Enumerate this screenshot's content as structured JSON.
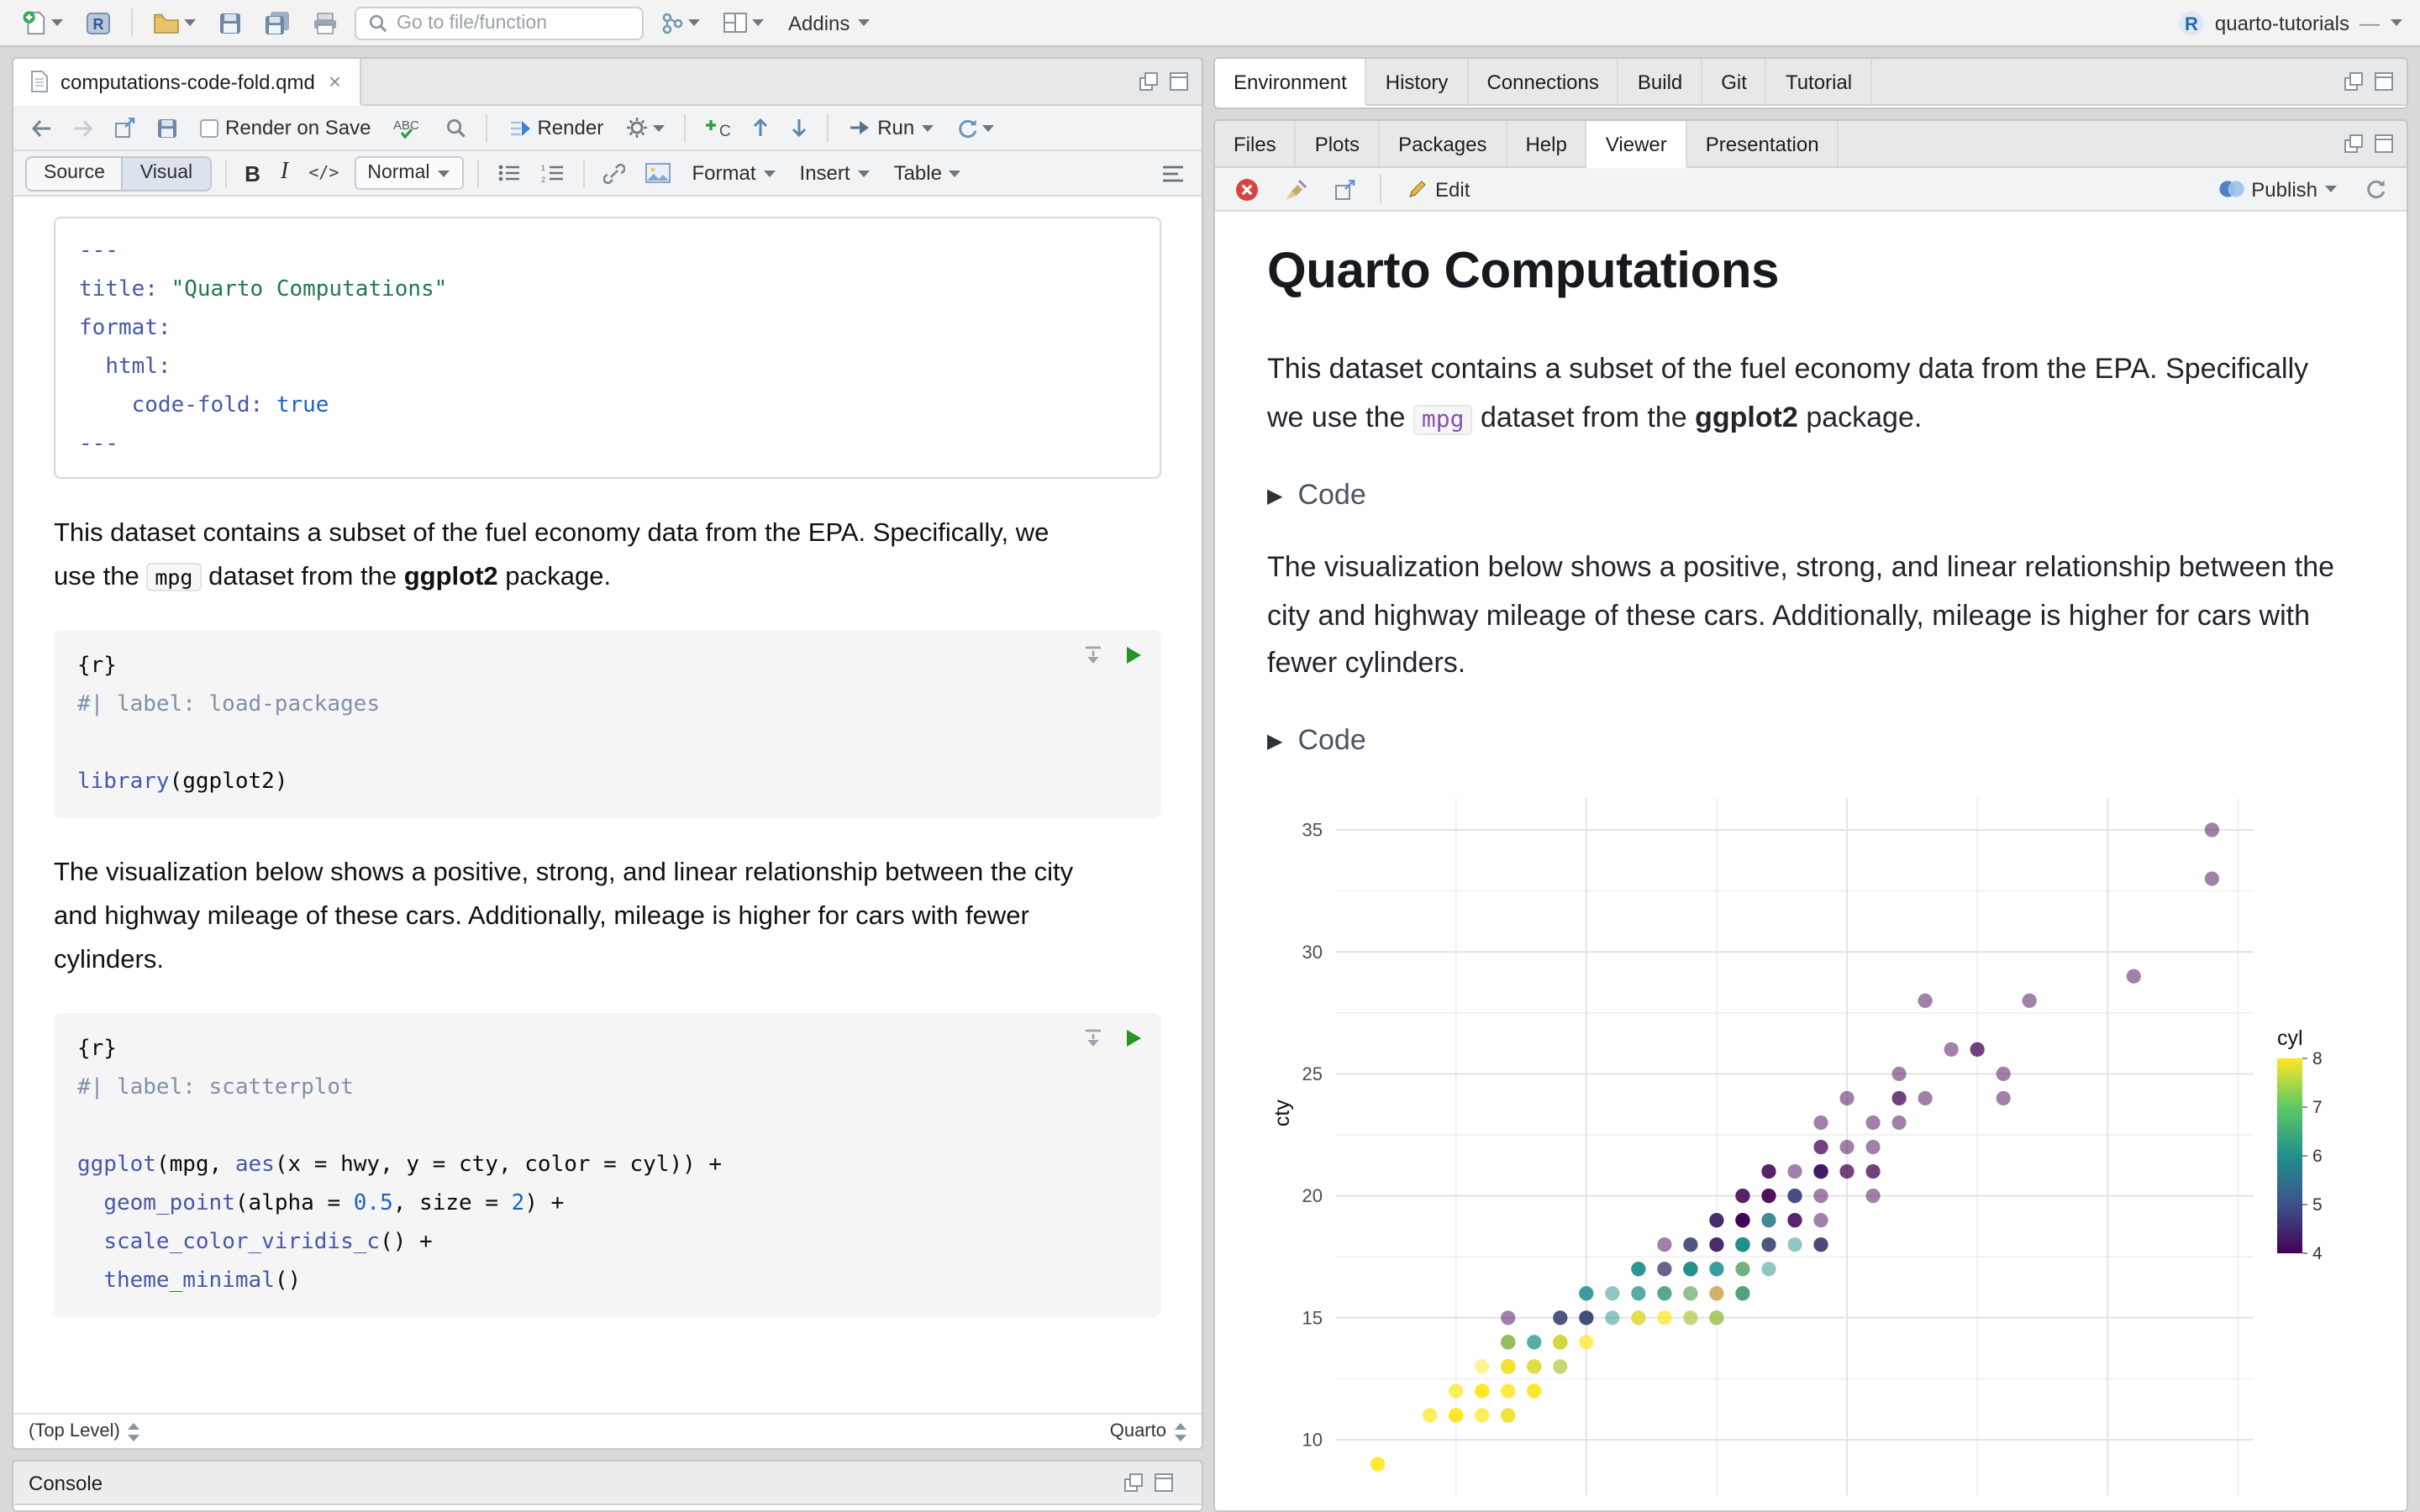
{
  "main_toolbar": {
    "goto_placeholder": "Go to file/function",
    "addins_label": "Addins",
    "project_name": "quarto-tutorials"
  },
  "editor_pane": {
    "tab_title": "computations-code-fold.qmd",
    "tab_close": "×",
    "toolbar": {
      "render_on_save_label": "Render on Save",
      "render_label": "Render",
      "run_label": "Run"
    },
    "format_bar": {
      "source_label": "Source",
      "visual_label": "Visual",
      "bold_label": "B",
      "italic_label": "I",
      "code_label": "</>",
      "paragraph_style": "Normal",
      "format_label": "Format",
      "insert_label": "Insert",
      "table_label": "Table"
    },
    "yaml_block": [
      [
        [
          "blu",
          "---"
        ]
      ],
      [
        [
          "blu",
          "title:"
        ],
        [
          "pl",
          " "
        ],
        [
          "grn",
          "\"Quarto Computations\""
        ]
      ],
      [
        [
          "blu",
          "format:"
        ]
      ],
      [
        [
          "pl",
          "  "
        ],
        [
          "blu",
          "html:"
        ]
      ],
      [
        [
          "pl",
          "    "
        ],
        [
          "blu",
          "code-fold:"
        ],
        [
          "pl",
          " "
        ],
        [
          "num",
          "true"
        ]
      ],
      [
        [
          "blu",
          "---"
        ]
      ]
    ],
    "paragraph_1": [
      {
        "s": "plain",
        "t": "This dataset contains a subset of the fuel economy data from the EPA. Specifically, we use the "
      },
      {
        "s": "code",
        "t": "mpg"
      },
      {
        "s": "plain",
        "t": " dataset from the "
      },
      {
        "s": "bold",
        "t": "ggplot2"
      },
      {
        "s": "plain",
        "t": " package."
      }
    ],
    "chunk_1": [
      [
        [
          "pl",
          "{r}"
        ]
      ],
      [
        [
          "cmt",
          "#| label: load-packages"
        ]
      ],
      [],
      [
        [
          "blu",
          "library"
        ],
        [
          "pl",
          "(ggplot2)"
        ]
      ]
    ],
    "paragraph_2": [
      {
        "s": "plain",
        "t": "The visualization below shows a positive, strong, and linear relationship between the city and highway mileage of these cars. Additionally, mileage is higher for cars with fewer cylinders."
      }
    ],
    "chunk_2": [
      [
        [
          "pl",
          "{r}"
        ]
      ],
      [
        [
          "cmt",
          "#| label: scatterplot"
        ]
      ],
      [],
      [
        [
          "blu",
          "ggplot"
        ],
        [
          "pl",
          "(mpg, "
        ],
        [
          "blu",
          "aes"
        ],
        [
          "pl",
          "(x = hwy, y = cty, color = cyl)) +"
        ]
      ],
      [
        [
          "pl",
          "  "
        ],
        [
          "blu",
          "geom_point"
        ],
        [
          "pl",
          "(alpha = "
        ],
        [
          "num",
          "0.5"
        ],
        [
          "pl",
          ", size = "
        ],
        [
          "num",
          "2"
        ],
        [
          "pl",
          ") +"
        ]
      ],
      [
        [
          "pl",
          "  "
        ],
        [
          "blu",
          "scale_color_viridis_c"
        ],
        [
          "pl",
          "() +"
        ]
      ],
      [
        [
          "pl",
          "  "
        ],
        [
          "blu",
          "theme_minimal"
        ],
        [
          "pl",
          "()"
        ]
      ]
    ],
    "status_bar": {
      "left": "(Top Level)",
      "right": "Quarto"
    }
  },
  "console_pane": {
    "title": "Console"
  },
  "environment_pane": {
    "tabs": [
      "Environment",
      "History",
      "Connections",
      "Build",
      "Git",
      "Tutorial"
    ]
  },
  "viewer_pane": {
    "tabs": [
      "Files",
      "Plots",
      "Packages",
      "Help",
      "Viewer",
      "Presentation"
    ],
    "active_tab": "Viewer",
    "toolbar": {
      "edit_label": "Edit",
      "publish_label": "Publish"
    },
    "document": {
      "title": "Quarto Computations",
      "paragraph_1": [
        {
          "s": "plain",
          "t": "This dataset contains a subset of the fuel economy data from the EPA. Specifically we use the "
        },
        {
          "s": "code",
          "t": "mpg"
        },
        {
          "s": "plain",
          "t": " dataset from the "
        },
        {
          "s": "bold",
          "t": "ggplot2"
        },
        {
          "s": "plain",
          "t": " package."
        }
      ],
      "code_fold_label": "Code",
      "paragraph_2": [
        {
          "s": "plain",
          "t": "The visualization below shows a positive, strong, and linear relationship between the city and highway mileage of these cars. Additionally, mileage is higher for cars with fewer cylinders."
        }
      ]
    }
  },
  "chart_data": {
    "type": "scatter",
    "x_var": "hwy",
    "ylabel": "cty",
    "x_domain": [
      10.4,
      45.6
    ],
    "y_domain": [
      7.7,
      36.3
    ],
    "y_ticks": [
      10,
      15,
      20,
      25,
      30,
      35
    ],
    "y_minor_gridlines": [
      12.5,
      17.5,
      22.5,
      27.5,
      32.5
    ],
    "x_major_gridlines": [
      20,
      30,
      40
    ],
    "x_minor_gridlines": [
      15,
      25,
      35,
      45
    ],
    "x_axis_labels_visible": false,
    "grid": true,
    "point_alpha": 0.5,
    "point_radius": 4.3,
    "color_scale": {
      "variable": "cyl",
      "name": "viridis",
      "domain": [
        4,
        8
      ],
      "stops": [
        "#440154",
        "#3b528b",
        "#21908c",
        "#5dc863",
        "#fde725"
      ],
      "legend_title": "cyl",
      "legend_ticks": [
        8,
        7,
        6,
        5,
        4
      ],
      "legend_position": "right"
    },
    "point_key": [
      "hwy",
      "cty",
      "cyl"
    ],
    "points": [
      [
        29,
        18,
        4
      ],
      [
        29,
        21,
        4
      ],
      [
        31,
        20,
        4
      ],
      [
        30,
        21,
        4
      ],
      [
        26,
        16,
        6
      ],
      [
        26,
        18,
        6
      ],
      [
        27,
        18,
        6
      ],
      [
        26,
        18,
        4
      ],
      [
        25,
        16,
        4
      ],
      [
        28,
        20,
        4
      ],
      [
        27,
        19,
        4
      ],
      [
        25,
        15,
        6
      ],
      [
        25,
        17,
        6
      ],
      [
        25,
        17,
        6
      ],
      [
        25,
        15,
        6
      ],
      [
        24,
        15,
        6
      ],
      [
        25,
        17,
        6
      ],
      [
        23,
        16,
        8
      ],
      [
        20,
        14,
        8
      ],
      [
        15,
        11,
        8
      ],
      [
        20,
        14,
        8
      ],
      [
        17,
        13,
        8
      ],
      [
        17,
        12,
        8
      ],
      [
        26,
        16,
        8
      ],
      [
        23,
        15,
        8
      ],
      [
        26,
        16,
        8
      ],
      [
        24,
        15,
        8
      ],
      [
        25,
        15,
        8
      ],
      [
        19,
        14,
        8
      ],
      [
        14,
        11,
        8
      ],
      [
        15,
        11,
        8
      ],
      [
        19,
        14,
        8
      ],
      [
        27,
        19,
        6
      ],
      [
        30,
        22,
        4
      ],
      [
        29,
        18,
        6
      ],
      [
        26,
        17,
        6
      ],
      [
        27,
        18,
        6
      ],
      [
        24,
        18,
        6
      ],
      [
        24,
        17,
        6
      ],
      [
        22,
        16,
        6
      ],
      [
        22,
        16,
        6
      ],
      [
        22,
        17,
        6
      ],
      [
        21,
        15,
        6
      ],
      [
        23,
        17,
        6
      ],
      [
        23,
        16,
        6
      ],
      [
        17,
        11,
        6
      ],
      [
        22,
        15,
        6
      ],
      [
        21,
        16,
        6
      ],
      [
        19,
        15,
        6
      ],
      [
        18,
        14,
        6
      ],
      [
        17,
        13,
        8
      ],
      [
        17,
        13,
        8
      ],
      [
        12,
        9,
        8
      ],
      [
        17,
        13,
        8
      ],
      [
        16,
        12,
        8
      ],
      [
        19,
        14,
        6
      ],
      [
        17,
        12,
        8
      ],
      [
        17,
        13,
        6
      ],
      [
        12,
        9,
        8
      ],
      [
        17,
        13,
        8
      ],
      [
        17,
        13,
        8
      ],
      [
        16,
        11,
        8
      ],
      [
        18,
        13,
        8
      ],
      [
        15,
        11,
        8
      ],
      [
        17,
        13,
        8
      ],
      [
        15,
        11,
        8
      ],
      [
        16,
        12,
        8
      ],
      [
        12,
        9,
        8
      ],
      [
        15,
        11,
        8
      ],
      [
        16,
        12,
        8
      ],
      [
        15,
        12,
        8
      ],
      [
        16,
        12,
        8
      ],
      [
        17,
        12,
        8
      ],
      [
        15,
        11,
        8
      ],
      [
        17,
        11,
        8
      ],
      [
        17,
        11,
        8
      ],
      [
        18,
        12,
        8
      ],
      [
        17,
        14,
        6
      ],
      [
        17,
        13,
        6
      ],
      [
        19,
        14,
        6
      ],
      [
        18,
        13,
        6
      ],
      [
        17,
        13,
        6
      ],
      [
        18,
        14,
        6
      ],
      [
        15,
        12,
        8
      ],
      [
        16,
        12,
        8
      ],
      [
        17,
        13,
        8
      ],
      [
        17,
        13,
        8
      ],
      [
        15,
        11,
        8
      ],
      [
        16,
        12,
        8
      ],
      [
        16,
        13,
        8
      ],
      [
        26,
        18,
        6
      ],
      [
        25,
        18,
        6
      ],
      [
        26,
        18,
        6
      ],
      [
        24,
        17,
        6
      ],
      [
        22,
        15,
        8
      ],
      [
        23,
        15,
        8
      ],
      [
        22,
        15,
        8
      ],
      [
        24,
        16,
        8
      ],
      [
        26,
        17,
        8
      ],
      [
        33,
        28,
        4
      ],
      [
        32,
        24,
        4
      ],
      [
        32,
        25,
        4
      ],
      [
        29,
        23,
        4
      ],
      [
        32,
        24,
        4
      ],
      [
        34,
        26,
        4
      ],
      [
        36,
        25,
        4
      ],
      [
        36,
        24,
        4
      ],
      [
        29,
        21,
        4
      ],
      [
        26,
        18,
        4
      ],
      [
        27,
        18,
        4
      ],
      [
        28,
        19,
        4
      ],
      [
        26,
        18,
        4
      ],
      [
        26,
        18,
        6
      ],
      [
        24,
        17,
        6
      ],
      [
        24,
        16,
        6
      ],
      [
        26,
        19,
        4
      ],
      [
        29,
        19,
        4
      ],
      [
        27,
        20,
        4
      ],
      [
        27,
        20,
        4
      ],
      [
        26,
        20,
        4
      ],
      [
        24,
        17,
        6
      ],
      [
        24,
        17,
        6
      ],
      [
        20,
        15,
        6
      ],
      [
        22,
        17,
        6
      ],
      [
        19,
        14,
        8
      ],
      [
        12,
        9,
        8
      ],
      [
        19,
        14,
        8
      ],
      [
        14,
        11,
        8
      ],
      [
        15,
        11,
        8
      ],
      [
        16,
        12,
        8
      ],
      [
        15,
        11,
        8
      ],
      [
        18,
        12,
        8
      ],
      [
        15,
        11,
        8
      ],
      [
        18,
        12,
        8
      ],
      [
        17,
        11,
        8
      ],
      [
        16,
        11,
        8
      ],
      [
        18,
        12,
        8
      ],
      [
        17,
        14,
        6
      ],
      [
        19,
        13,
        6
      ],
      [
        19,
        13,
        8
      ],
      [
        17,
        13,
        8
      ],
      [
        29,
        21,
        4
      ],
      [
        32,
        23,
        4
      ],
      [
        31,
        23,
        4
      ],
      [
        26,
        19,
        6
      ],
      [
        27,
        19,
        6
      ],
      [
        25,
        18,
        6
      ],
      [
        25,
        19,
        6
      ],
      [
        25,
        19,
        6
      ],
      [
        17,
        14,
        6
      ],
      [
        17,
        14,
        6
      ],
      [
        18,
        12,
        8
      ],
      [
        18,
        13,
        8
      ],
      [
        24,
        18,
        6
      ],
      [
        26,
        18,
        6
      ],
      [
        26,
        16,
        6
      ],
      [
        27,
        17,
        6
      ],
      [
        28,
        18,
        6
      ],
      [
        25,
        16,
        8
      ],
      [
        25,
        18,
        4
      ],
      [
        24,
        18,
        4
      ],
      [
        27,
        20,
        4
      ],
      [
        25,
        19,
        4
      ],
      [
        23,
        18,
        4
      ],
      [
        25,
        18,
        4
      ],
      [
        26,
        19,
        4
      ],
      [
        27,
        20,
        4
      ],
      [
        26,
        19,
        4
      ],
      [
        26,
        20,
        4
      ],
      [
        27,
        21,
        4
      ],
      [
        25,
        19,
        4
      ],
      [
        26,
        20,
        4
      ],
      [
        23,
        17,
        4
      ],
      [
        20,
        15,
        6
      ],
      [
        20,
        16,
        6
      ],
      [
        20,
        16,
        6
      ],
      [
        19,
        15,
        6
      ],
      [
        17,
        14,
        8
      ],
      [
        17,
        13,
        8
      ],
      [
        29,
        21,
        4
      ],
      [
        27,
        21,
        4
      ],
      [
        31,
        21,
        4
      ],
      [
        26,
        18,
        6
      ],
      [
        23,
        16,
        6
      ],
      [
        26,
        18,
        6
      ],
      [
        28,
        19,
        4
      ],
      [
        29,
        21,
        4
      ],
      [
        27,
        21,
        4
      ],
      [
        31,
        21,
        4
      ],
      [
        26,
        18,
        6
      ],
      [
        26,
        18,
        6
      ],
      [
        28,
        20,
        4
      ],
      [
        26,
        19,
        4
      ],
      [
        30,
        24,
        4
      ],
      [
        33,
        24,
        4
      ],
      [
        35,
        26,
        4
      ],
      [
        37,
        28,
        4
      ],
      [
        35,
        26,
        4
      ],
      [
        15,
        11,
        8
      ],
      [
        18,
        13,
        8
      ],
      [
        20,
        16,
        6
      ],
      [
        20,
        15,
        6
      ],
      [
        22,
        17,
        6
      ],
      [
        17,
        15,
        4
      ],
      [
        19,
        15,
        4
      ],
      [
        20,
        15,
        4
      ],
      [
        22,
        17,
        6
      ],
      [
        29,
        21,
        4
      ],
      [
        26,
        19,
        4
      ],
      [
        29,
        21,
        4
      ],
      [
        29,
        22,
        4
      ],
      [
        24,
        17,
        6
      ],
      [
        44,
        33,
        4
      ],
      [
        29,
        21,
        5
      ],
      [
        28,
        20,
        5
      ],
      [
        26,
        19,
        4
      ],
      [
        29,
        22,
        4
      ],
      [
        24,
        17,
        6
      ],
      [
        30,
        21,
        4
      ],
      [
        31,
        22,
        4
      ],
      [
        29,
        21,
        4
      ],
      [
        44,
        35,
        4
      ],
      [
        41,
        29,
        4
      ],
      [
        29,
        21,
        5
      ],
      [
        28,
        20,
        5
      ],
      [
        26,
        19,
        4
      ],
      [
        29,
        20,
        4
      ],
      [
        29,
        18,
        4
      ],
      [
        29,
        21,
        4
      ],
      [
        28,
        19,
        4
      ],
      [
        26,
        16,
        6
      ],
      [
        26,
        18,
        6
      ],
      [
        26,
        17,
        6
      ],
      [
        28,
        21,
        4
      ]
    ]
  }
}
